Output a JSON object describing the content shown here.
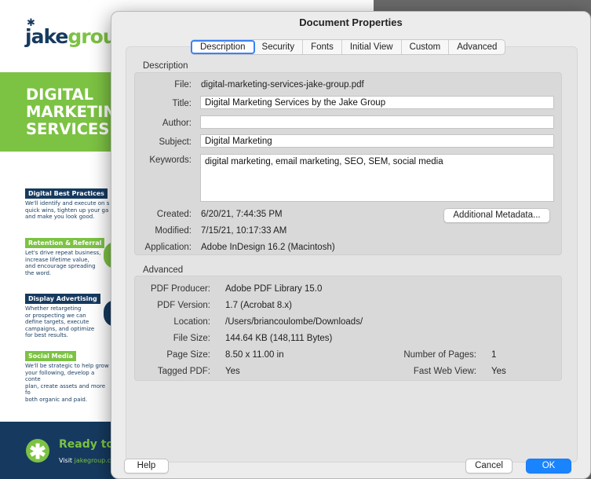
{
  "background_doc": {
    "logo_jake": "jake",
    "logo_group": "group",
    "hero_title": "DIGITAL\nMARKETING\nSERVICES",
    "services": [
      {
        "tag": "Digital Best Practices",
        "desc": "We'll identify and execute on s\nquick wins, tighten up your ga\nand make you look good."
      },
      {
        "tag": "Retention & Referral",
        "desc": "Let's drive repeat business,\nincrease lifetime value,\nand encourage spreading\nthe word."
      },
      {
        "tag": "Display Advertising",
        "desc": "Whether retargeting\nor prospecting we can\ndefine targets, execute\ncampaigns, and optimize\nfor best results."
      },
      {
        "tag": "Social Media",
        "desc": "We'll be strategic to help grow\nyour following, develop a conte\nplan, create assets and more fo\nboth organic and paid."
      }
    ],
    "footer_title": "Ready to g",
    "footer_visit_prefix": "Visit ",
    "footer_visit_link": "jakegroup.c",
    "brand_colors": {
      "navy": "#163a5f",
      "green": "#7cc243"
    }
  },
  "dialog": {
    "title": "Document Properties",
    "tabs": [
      {
        "label": "Description",
        "active": true
      },
      {
        "label": "Security"
      },
      {
        "label": "Fonts"
      },
      {
        "label": "Initial View"
      },
      {
        "label": "Custom"
      },
      {
        "label": "Advanced"
      }
    ],
    "description": {
      "section_label": "Description",
      "file_label": "File:",
      "file_value": "digital-marketing-services-jake-group.pdf",
      "title_label": "Title:",
      "title_value": "Digital Marketing Services by the Jake Group",
      "author_label": "Author:",
      "author_value": "",
      "subject_label": "Subject:",
      "subject_value": "Digital Marketing",
      "keywords_label": "Keywords:",
      "keywords_value": "digital marketing, email marketing, SEO, SEM, social media",
      "created_label": "Created:",
      "created_value": "6/20/21, 7:44:35 PM",
      "modified_label": "Modified:",
      "modified_value": "7/15/21, 10:17:33 AM",
      "application_label": "Application:",
      "application_value": "Adobe InDesign 16.2 (Macintosh)",
      "additional_metadata_button": "Additional Metadata..."
    },
    "advanced": {
      "section_label": "Advanced",
      "producer_label": "PDF Producer:",
      "producer_value": "Adobe PDF Library 15.0",
      "version_label": "PDF Version:",
      "version_value": "1.7 (Acrobat 8.x)",
      "location_label": "Location:",
      "location_value": "/Users/briancoulombe/Downloads/",
      "filesize_label": "File Size:",
      "filesize_value": "144.64 KB (148,111 Bytes)",
      "pagesize_label": "Page Size:",
      "pagesize_value": "8.50 x 11.00 in",
      "numpages_label": "Number of Pages:",
      "numpages_value": "1",
      "tagged_label": "Tagged PDF:",
      "tagged_value": "Yes",
      "fastweb_label": "Fast Web View:",
      "fastweb_value": "Yes"
    },
    "buttons": {
      "help": "Help",
      "cancel": "Cancel",
      "ok": "OK"
    },
    "accent_color": "#1a84ff"
  }
}
